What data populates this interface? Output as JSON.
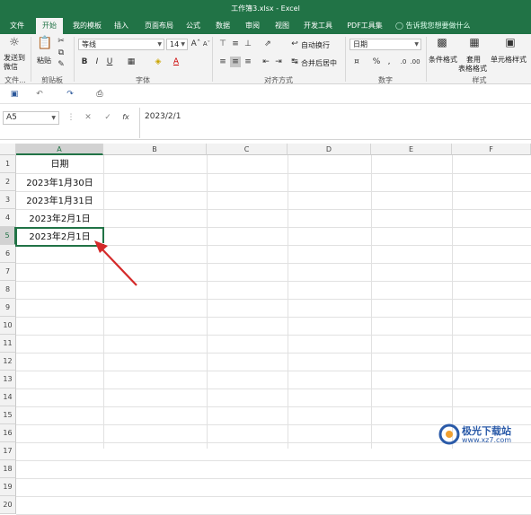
{
  "window": {
    "title": "工作簿3.xlsx - Excel"
  },
  "tabs": [
    {
      "label": "文件",
      "active": false
    },
    {
      "label": "开始",
      "active": true
    },
    {
      "label": "我的模板",
      "active": false
    },
    {
      "label": "插入",
      "active": false
    },
    {
      "label": "页面布局",
      "active": false
    },
    {
      "label": "公式",
      "active": false
    },
    {
      "label": "数据",
      "active": false
    },
    {
      "label": "审阅",
      "active": false
    },
    {
      "label": "视图",
      "active": false
    },
    {
      "label": "开发工具",
      "active": false
    },
    {
      "label": "PDF工具集",
      "active": false
    }
  ],
  "tell_me": "告诉我您想要做什么",
  "ribbon": {
    "send_wechat": "发送到微信",
    "file_group_label": "文件...",
    "paste": "粘贴",
    "clipboard_label": "剪贴板",
    "font_name": "等线",
    "font_size": "14",
    "font_label": "字体",
    "wrap_text": "自动换行",
    "merge_center": "合并后居中",
    "alignment_label": "对齐方式",
    "number_format": "日期",
    "number_label": "数字",
    "conditional_format": "条件格式",
    "format_as_table_1": "套用",
    "format_as_table_2": "表格格式",
    "cell_styles": "单元格样式",
    "styles_label": "样式",
    "bold": "B",
    "italic": "I",
    "underline": "U",
    "font_color_letter": "A",
    "percent": "%",
    "comma": ","
  },
  "formula_bar": {
    "name_box": "A5",
    "fx": "fx",
    "formula": "2023/2/1"
  },
  "columns": [
    "A",
    "B",
    "C",
    "D",
    "E",
    "F"
  ],
  "rows": [
    "1",
    "2",
    "3",
    "4",
    "5",
    "6",
    "7",
    "8",
    "9",
    "10",
    "11",
    "12",
    "13",
    "14",
    "15",
    "16",
    "17",
    "18",
    "19",
    "20"
  ],
  "cells": {
    "A1": "日期",
    "A2": "2023年1月30日",
    "A3": "2023年1月31日",
    "A4": "2023年2月1日",
    "A5": "2023年2月1日"
  },
  "selected_cell": "A5",
  "watermark": {
    "site_name": "极光下载站",
    "url": "www.xz7.com"
  },
  "colors": {
    "excel_green": "#217346",
    "arrow_red": "#d42a2a"
  }
}
